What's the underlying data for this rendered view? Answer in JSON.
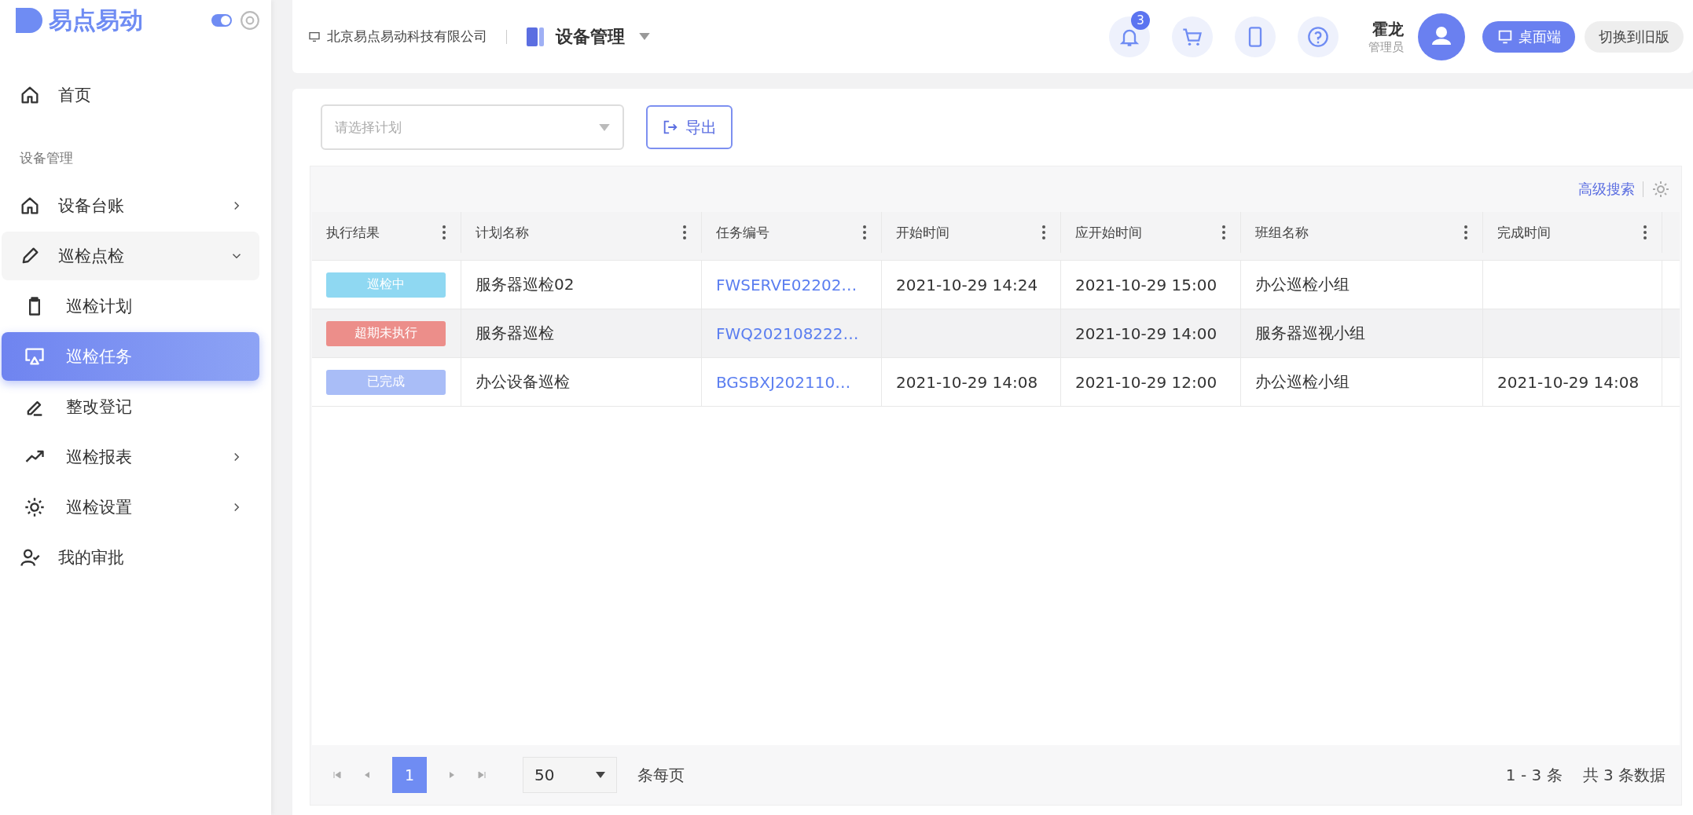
{
  "sidebar": {
    "logo_text": "易点易动",
    "theme_switch": {
      "on": true
    },
    "items": [
      {
        "label": "首页",
        "kind": "item"
      },
      {
        "label": "设备管理",
        "kind": "section"
      },
      {
        "label": "设备台账",
        "kind": "group",
        "expanded": false
      },
      {
        "label": "巡检点检",
        "kind": "group",
        "expanded": true,
        "children": [
          {
            "label": "巡检计划",
            "selected": false
          },
          {
            "label": "巡检任务",
            "selected": true
          },
          {
            "label": "整改登记",
            "selected": false
          },
          {
            "label": "巡检报表",
            "selected": false,
            "expanded": false
          },
          {
            "label": "巡检设置",
            "selected": false,
            "expanded": false
          }
        ]
      },
      {
        "label": "我的审批",
        "kind": "item"
      }
    ]
  },
  "header": {
    "company": "北京易点易动科技有限公司",
    "module": "设备管理",
    "notification_count": "3",
    "user_name": "霍龙",
    "user_role": "管理员",
    "desktop_button": "桌面端",
    "old_version_button": "切换到旧版"
  },
  "toolbar": {
    "plan_select": {
      "placeholder": "请选择计划"
    },
    "export_button": "导出"
  },
  "table": {
    "advanced_search": "高级搜索",
    "columns": [
      "执行结果",
      "计划名称",
      "任务编号",
      "开始时间",
      "应开始时间",
      "班组名称",
      "完成时间"
    ],
    "rows": [
      {
        "selected": false,
        "cells": [
          {
            "label": "巡检中",
            "color": "#8fd8f2"
          },
          "服务器巡检02",
          "FWSERVE02202…",
          "2021-10-29 14:24",
          "2021-10-29 15:00",
          "办公巡检小组",
          ""
        ]
      },
      {
        "selected": true,
        "cells": [
          {
            "label": "超期未执行",
            "color": "#ec8e8a"
          },
          "服务器巡检",
          "FWQ202108222…",
          "",
          "2021-10-29 14:00",
          "服务器巡视小组",
          ""
        ]
      },
      {
        "selected": false,
        "cells": [
          {
            "label": "已完成",
            "color": "#a9bdf7"
          },
          "办公设备巡检",
          "BGSBXJ202110…",
          "2021-10-29 14:08",
          "2021-10-29 12:00",
          "办公巡检小组",
          "2021-10-29 14:08"
        ]
      }
    ]
  },
  "pagination": {
    "pages": [
      {
        "label": "1",
        "selected": true
      }
    ],
    "page_size": "50",
    "page_size_label": "条每页",
    "range": "1 - 3 条",
    "total": "共 3 条数据"
  }
}
